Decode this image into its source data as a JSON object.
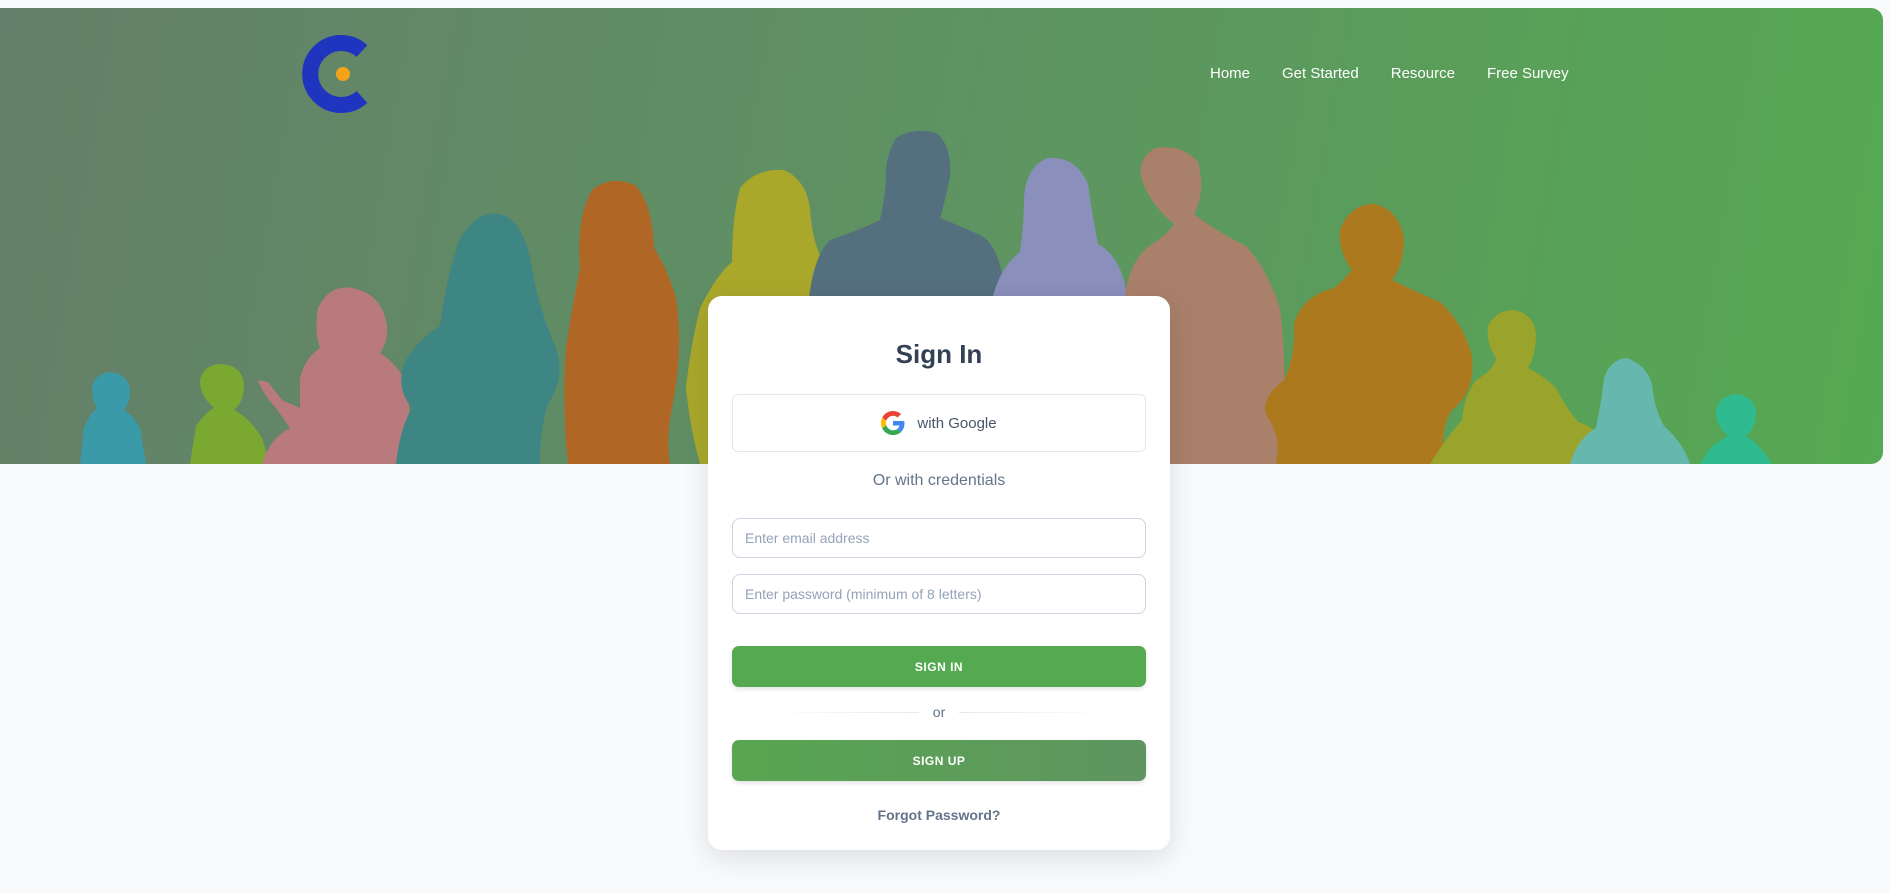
{
  "header": {
    "logo": "app-logo",
    "nav": [
      {
        "label": "Home"
      },
      {
        "label": "Get Started"
      },
      {
        "label": "Resource"
      },
      {
        "label": "Free Survey"
      }
    ]
  },
  "signin": {
    "title": "Sign In",
    "google_label": "with Google",
    "google_icon": "google-icon",
    "or_credentials": "Or with credentials",
    "email_placeholder": "Enter email address",
    "email_value": "",
    "password_placeholder": "Enter password (minimum of 8 letters)",
    "password_value": "",
    "signin_label": "SIGN IN",
    "or_label": "or",
    "signup_label": "SIGN UP",
    "forgot_label": "Forgot Password?"
  },
  "colors": {
    "primary_green": "#55a951",
    "logo_blue": "#1f35c0",
    "logo_dot": "#f5a21b",
    "page_bg": "#f8fafc"
  }
}
